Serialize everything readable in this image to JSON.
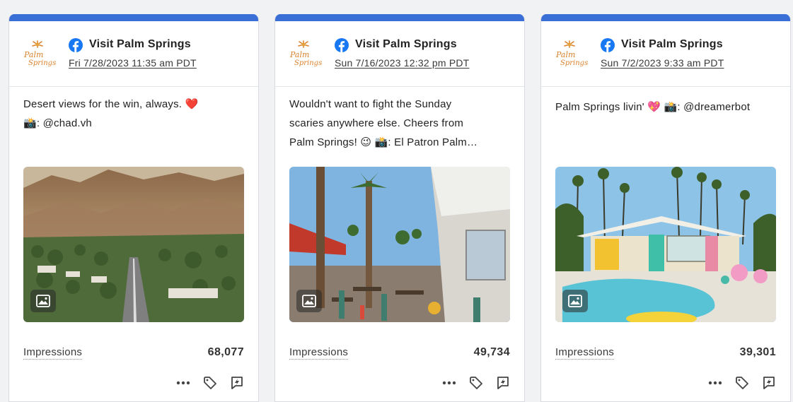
{
  "colors": {
    "accent_bar": "#3b6fd8",
    "facebook_blue": "#1877f2"
  },
  "posts": [
    {
      "account": "Visit Palm Springs",
      "network_icon": "facebook-icon",
      "date": "Fri 7/28/2023 11:35 am PDT",
      "caption_line1": "Desert views for the win, always. ❤️",
      "caption_line2": "📸: @chad.vh",
      "caption_line3": "",
      "image_icon": "image-icon",
      "metric_label": "Impressions",
      "metric_value": "68,077"
    },
    {
      "account": "Visit Palm Springs",
      "network_icon": "facebook-icon",
      "date": "Sun 7/16/2023 12:32 pm PDT",
      "caption_line1": "Wouldn't want to fight the Sunday",
      "caption_line2": "scaries anywhere else. Cheers from",
      "caption_line3": "Palm Springs! 😉 📸: El Patron Palm…",
      "image_icon": "image-icon",
      "metric_label": "Impressions",
      "metric_value": "49,734"
    },
    {
      "account": "Visit Palm Springs",
      "network_icon": "facebook-icon",
      "date": "Sun 7/2/2023 9:33 am PDT",
      "caption_line1": "Palm Springs livin' 💖 📸: @dreamerbot",
      "caption_line2": "",
      "caption_line3": "",
      "image_icon": "image-icon",
      "metric_label": "Impressions",
      "metric_value": "39,301"
    }
  ]
}
